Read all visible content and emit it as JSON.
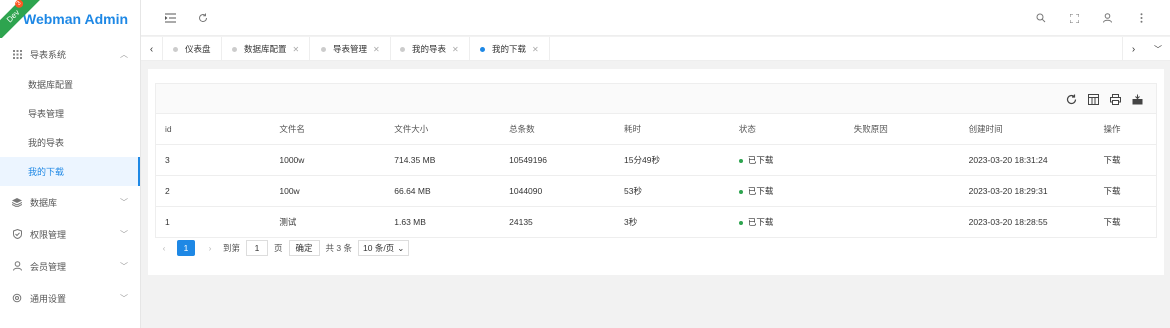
{
  "app": {
    "title": "Webman Admin",
    "env_badge": "Dev",
    "env_count": "3"
  },
  "sidebar": {
    "groups": [
      {
        "label": "导表系统",
        "icon": "grid-icon",
        "expanded": true
      },
      {
        "label": "数据库",
        "icon": "database-icon"
      },
      {
        "label": "权限管理",
        "icon": "shield-icon"
      },
      {
        "label": "会员管理",
        "icon": "user-icon"
      },
      {
        "label": "通用设置",
        "icon": "gear-icon"
      }
    ],
    "sub_items": [
      "数据库配置",
      "导表管理",
      "我的导表",
      "我的下载"
    ],
    "active_sub": "我的下载"
  },
  "tabs": [
    {
      "label": "仪表盘",
      "closable": false
    },
    {
      "label": "数据库配置",
      "closable": true
    },
    {
      "label": "导表管理",
      "closable": true
    },
    {
      "label": "我的导表",
      "closable": true
    },
    {
      "label": "我的下载",
      "closable": true,
      "active": true
    }
  ],
  "table": {
    "columns": [
      "id",
      "文件名",
      "文件大小",
      "总条数",
      "耗时",
      "状态",
      "失败原因",
      "创建时间",
      "操作"
    ],
    "rows": [
      [
        "3",
        "1000w",
        "714.35 MB",
        "10549196",
        "15分49秒",
        "已下载",
        "",
        "2023-03-20 18:31:24",
        "下载"
      ],
      [
        "2",
        "100w",
        "66.64 MB",
        "1044090",
        "53秒",
        "已下载",
        "",
        "2023-03-20 18:29:31",
        "下载"
      ],
      [
        "1",
        "测试",
        "1.63 MB",
        "24135",
        "3秒",
        "已下载",
        "",
        "2023-03-20 18:28:55",
        "下载"
      ]
    ]
  },
  "pager": {
    "current": "1",
    "goto_label": "到第",
    "goto_value": "1",
    "page_label": "页",
    "confirm_label": "确定",
    "total_label": "共 3 条",
    "page_size": "10 条/页"
  },
  "colors": {
    "accent": "#1e88e5",
    "status_ok": "#2ea44f",
    "ribbon": "#2ea44f"
  }
}
